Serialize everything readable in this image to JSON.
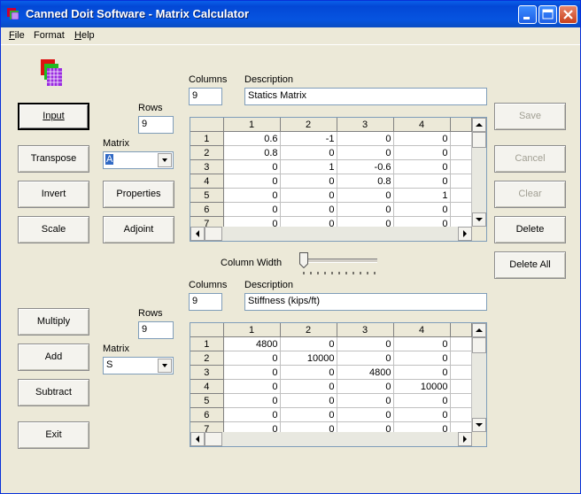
{
  "window": {
    "title": "Canned Doit Software - Matrix Calculator"
  },
  "menu": [
    {
      "label": "File",
      "u": "F",
      "rest": "ile"
    },
    {
      "label": "Format",
      "u": "",
      "rest": "Format"
    },
    {
      "label": "Help",
      "u": "H",
      "rest": "elp"
    }
  ],
  "left_buttons": {
    "input": "Input",
    "transpose": "Transpose",
    "invert": "Invert",
    "scale": "Scale",
    "properties": "Properties",
    "adjoint": "Adjoint",
    "multiply": "Multiply",
    "add": "Add",
    "subtract": "Subtract",
    "exit": "Exit"
  },
  "right_buttons": {
    "save": "Save",
    "cancel": "Cancel",
    "clear": "Clear",
    "delete": "Delete",
    "delete_all": "Delete All"
  },
  "top": {
    "rows_label": "Rows",
    "rows_value": "9",
    "matrix_label": "Matrix",
    "matrix_value": "A",
    "columns_label": "Columns",
    "columns_value": "9",
    "description_label": "Description",
    "description_value": "Statics Matrix",
    "grid": {
      "col_headers": [
        "1",
        "2",
        "3",
        "4",
        ""
      ],
      "rows": [
        [
          "1",
          "0.6",
          "-1",
          "0",
          "0"
        ],
        [
          "2",
          "0.8",
          "0",
          "0",
          "0"
        ],
        [
          "3",
          "0",
          "1",
          "-0.6",
          "0"
        ],
        [
          "4",
          "0",
          "0",
          "0.8",
          "0"
        ],
        [
          "5",
          "0",
          "0",
          "0",
          "1"
        ],
        [
          "6",
          "0",
          "0",
          "0",
          "0"
        ],
        [
          "7",
          "0",
          "0",
          "0",
          "0"
        ]
      ]
    }
  },
  "column_width_label": "Column Width",
  "bottom": {
    "rows_label": "Rows",
    "rows_value": "9",
    "matrix_label": "Matrix",
    "matrix_value": "S",
    "columns_label": "Columns",
    "columns_value": "9",
    "description_label": "Description",
    "description_value": "Stiffness (kips/ft)",
    "grid": {
      "col_headers": [
        "1",
        "2",
        "3",
        "4",
        ""
      ],
      "rows": [
        [
          "1",
          "4800",
          "0",
          "0",
          "0"
        ],
        [
          "2",
          "0",
          "10000",
          "0",
          "0"
        ],
        [
          "3",
          "0",
          "0",
          "4800",
          "0"
        ],
        [
          "4",
          "0",
          "0",
          "0",
          "10000"
        ],
        [
          "5",
          "0",
          "0",
          "0",
          "0"
        ],
        [
          "6",
          "0",
          "0",
          "0",
          "0"
        ],
        [
          "7",
          "0",
          "0",
          "0",
          "0"
        ]
      ]
    }
  }
}
